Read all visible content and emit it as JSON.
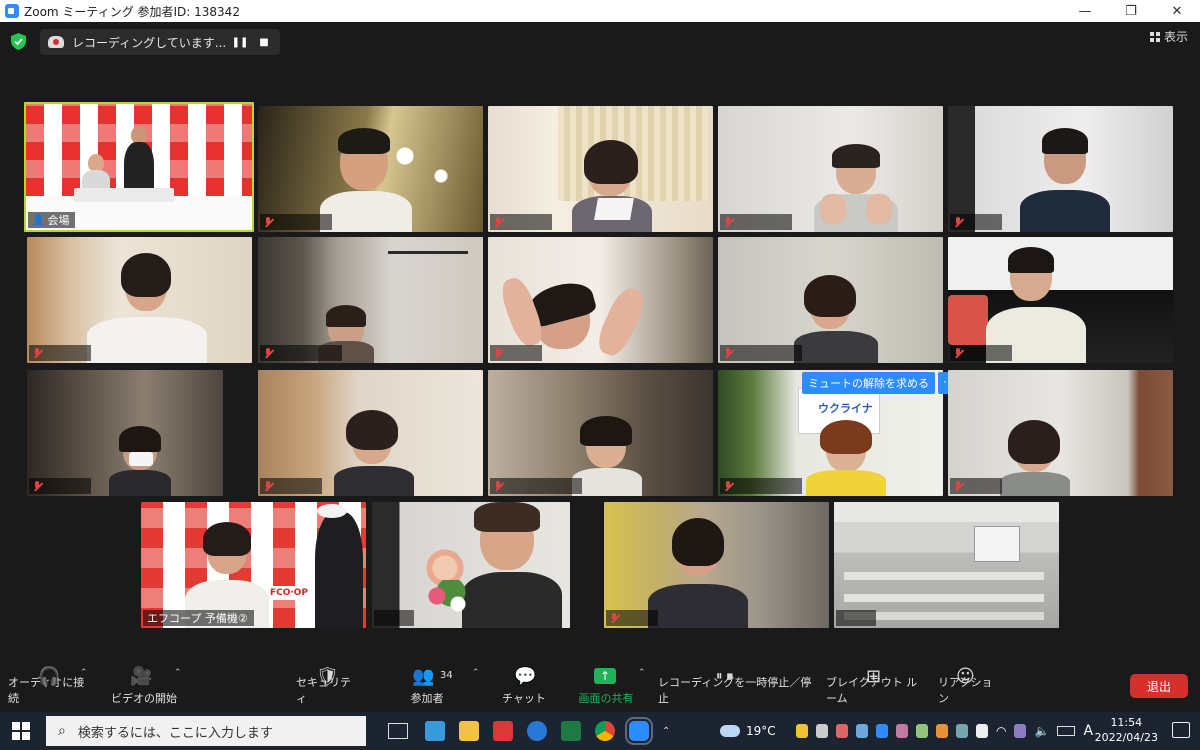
{
  "window": {
    "title": "Zoom ミーティング 参加者ID: 138342",
    "min": "—",
    "max": "❐",
    "close": "✕"
  },
  "recording": {
    "status": "レコーディングしています...",
    "pause": "❚❚",
    "stop": "■"
  },
  "view_label": "表示",
  "tiles": {
    "t1": "会場",
    "t20": "エフコープ 予備機②"
  },
  "unmute_request": {
    "label": "ミュートの解除を求める",
    "more": "⋯"
  },
  "signs": {
    "fcoop": "FCO·OP",
    "ukraine": "ウクライナ"
  },
  "toolbar": {
    "audio": "オーディオに接続",
    "video": "ビデオの開始",
    "security": "セキュリティ",
    "participants": "参加者",
    "participants_count": "34",
    "chat": "チャット",
    "share": "画面の共有",
    "record": "レコーディングを一時停止／停止",
    "breakout": "ブレイクアウト ルーム",
    "reactions": "リアクション",
    "leave": "退出"
  },
  "taskbar": {
    "search_placeholder": "検索するには、ここに入力します",
    "temperature": "19°C",
    "ime": "A",
    "time": "11:54",
    "date": "2022/04/23"
  },
  "colors": {
    "zoom_blue": "#2d8cff",
    "share_green": "#1fb45b",
    "leave_red": "#d5302c",
    "speaker_border": "#b5d82a"
  }
}
